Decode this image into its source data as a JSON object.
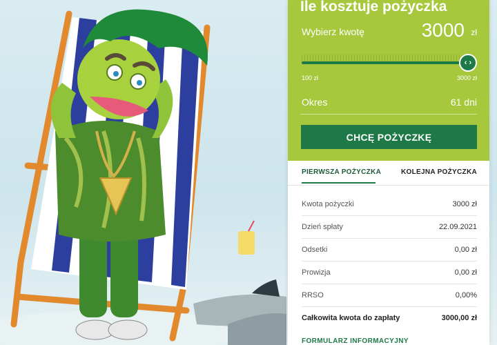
{
  "hero": {
    "description_icon": "mascot-on-deckchair"
  },
  "calculator": {
    "title": "Ile kosztuje pożyczka",
    "amount_label": "Wybierz kwotę",
    "amount_value": "3000",
    "amount_unit": "zł",
    "slider": {
      "min_label": "100 zł",
      "max_label": "3000 zł",
      "position_fraction": 1.0,
      "handle_icon": "chevron-left-right-icon",
      "handle_glyph": "‹ ›"
    },
    "term_label": "Okres",
    "term_value": "61 dni",
    "cta_label": "CHCĘ POŻYCZKĘ"
  },
  "tabs": [
    {
      "label": "PIERWSZA POŻYCZKA",
      "active": true
    },
    {
      "label": "KOLEJNA POŻYCZKA",
      "active": false
    }
  ],
  "details": [
    {
      "label": "Kwota pożyczki",
      "value": "3000 zł"
    },
    {
      "label": "Dzień spłaty",
      "value": "22.09.2021"
    },
    {
      "label": "Odsetki",
      "value": "0,00 zł"
    },
    {
      "label": "Prowizja",
      "value": "0,00 zł"
    },
    {
      "label": "RRSO",
      "value": "0,00%"
    },
    {
      "label": "Całkowita kwota do zapłaty",
      "value": "3000,00 zł"
    }
  ],
  "form_link": "FORMULARZ INFORMACYJNY",
  "colors": {
    "brand_green": "#a7c83c",
    "dark_green": "#1d7a47",
    "background": "#d9ecf1"
  }
}
